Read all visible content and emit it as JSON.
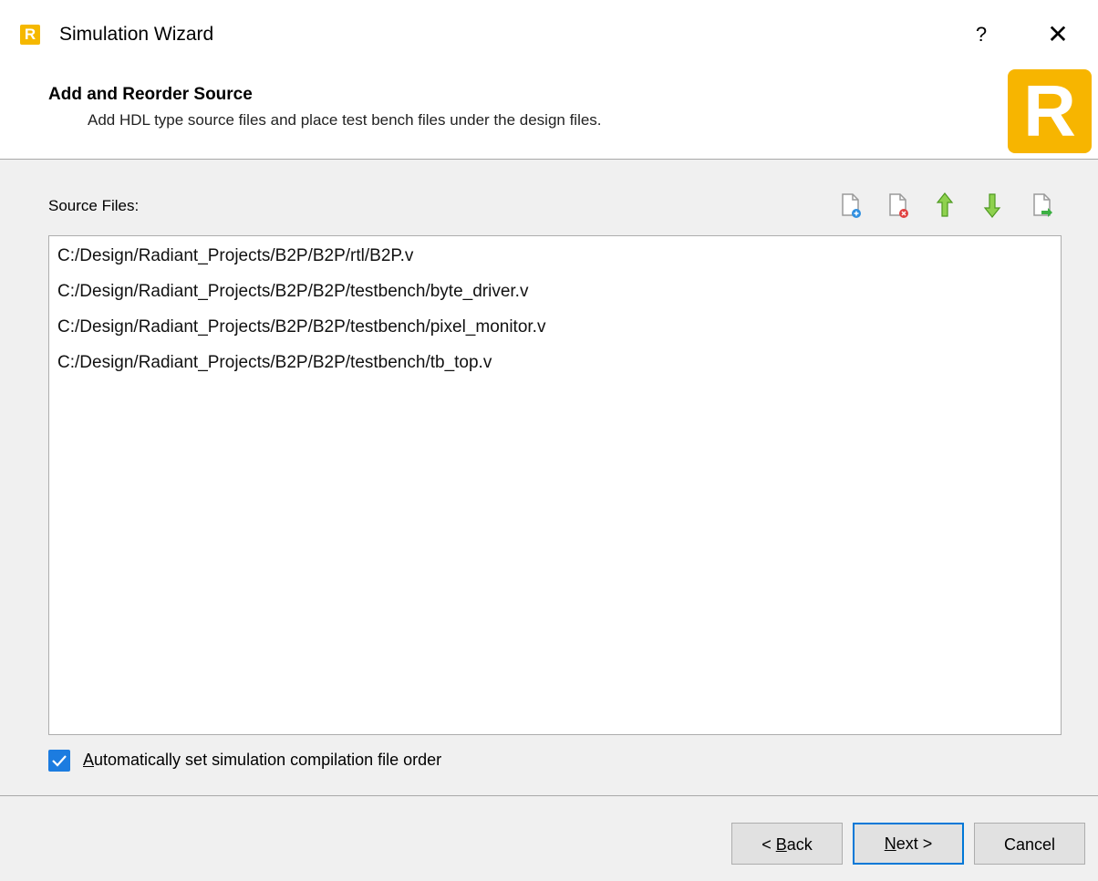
{
  "window": {
    "title": "Simulation Wizard",
    "help_label": "?",
    "close_label": "✕"
  },
  "header": {
    "title": "Add and Reorder Source",
    "subtitle": "Add HDL type source files and place test bench files under the design files.",
    "logo_letter": "R"
  },
  "source_files": {
    "label": "Source Files:",
    "toolbar": [
      {
        "name": "add-file-icon"
      },
      {
        "name": "remove-file-icon"
      },
      {
        "name": "move-up-icon"
      },
      {
        "name": "move-down-icon"
      },
      {
        "name": "import-file-icon"
      }
    ],
    "files": [
      "C:/Design/Radiant_Projects/B2P/B2P/rtl/B2P.v",
      "C:/Design/Radiant_Projects/B2P/B2P/testbench/byte_driver.v",
      "C:/Design/Radiant_Projects/B2P/B2P/testbench/pixel_monitor.v",
      "C:/Design/Radiant_Projects/B2P/B2P/testbench/tb_top.v"
    ]
  },
  "options": {
    "auto_order_checked": true,
    "auto_order_label_first": "A",
    "auto_order_label_rest": "utomatically set simulation compilation file order"
  },
  "buttons": {
    "back_prefix": "< ",
    "back_mnemonic": "B",
    "back_rest": "ack",
    "next_mnemonic": "N",
    "next_rest": "ext >",
    "cancel": "Cancel"
  },
  "colors": {
    "accent": "#0078d7",
    "logo": "#f7b500",
    "checkbox": "#1c7ce0"
  }
}
